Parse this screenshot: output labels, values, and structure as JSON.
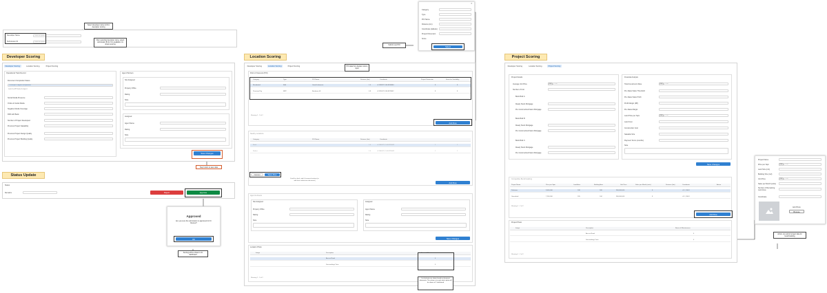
{
  "sections": {
    "developer": "Developer Scoring",
    "status": "Status Update",
    "location": "Location Scoring",
    "project": "Project Scoring"
  },
  "tabs": [
    "Developer Scoring",
    "Location Scoring",
    "Project Scoring"
  ],
  "top_form": {
    "developer_name": "Developer Name",
    "submission_id": "Submission ID",
    "placeholder": "Enter an option",
    "note1": "Select developer name & ID in developer scoring",
    "note2": "After selecting developer name, select submission ID & if it is available it is shown scoring"
  },
  "dev": {
    "op_track": "Operational Track Record",
    "doc_status": "Document Completion Status",
    "doc_opts": [
      "Developer & Agent Incorporated",
      "Land Lot/Private & Agent"
    ],
    "fields": [
      "Social Media Presence",
      "Online & Social Media",
      "Negative Media Coverage",
      "PAR with Bank",
      "Number of Project Developed",
      "Previous Project Saleability",
      "Previous Project Design Quality",
      "Previous Project Building Quality"
    ],
    "agent_partners": "Agent Partners",
    "not_assigned": "Not Assigned",
    "property_office": "Property Office",
    "rating": "Rating",
    "note": "Note",
    "assigned": "Assigned",
    "agent_name": "Agent Name",
    "save": "Save Changes",
    "dev_note": "Step button to save data"
  },
  "status": {
    "label": "Status",
    "remarks": "Remarks",
    "reject": "Reject",
    "approve": "Approve",
    "approved_title": "Approved",
    "approved_body": "Are you sure the submission is approved for IC Review?",
    "ok": "OK",
    "note": "Scoring will be shown in IC dashboard"
  },
  "location": {
    "poi_table": "Point of Interests (POI)",
    "columns": [
      "Category",
      "Type",
      "POI Name",
      "Distance (km)",
      "Coordinate",
      "Project Dimension",
      "Score for Scalability"
    ],
    "rows": [
      [
        "Residential",
        "Mall",
        "Grand Indonesia",
        "1.5",
        "-6.1938227,106.8208484",
        "8",
        "8"
      ],
      [
        "Premium/City",
        "MRT",
        "Bundaran HI",
        "0.8",
        "-6.1916071,106.8229442",
        "8",
        "8"
      ]
    ],
    "nearby": "Nearby Locations",
    "rows2": [
      [
        "Rank",
        "",
        "",
        "1.0",
        "-6.1940071, 106.8229442",
        "1",
        "1"
      ],
      [
        "Radius",
        "",
        "",
        "1.0",
        "-6.1940071, 106.8229442",
        "1",
        "1"
      ]
    ],
    "paging": "Showing 1 - 2 of 2",
    "add_row": "Add Row",
    "cancel": "Cancel",
    "save_row": "Save Row",
    "poi_note": "POI data from Apptax column input",
    "edit_note": "Scroll to check, add, & remove location (as add from submission document)",
    "agent_lbl": "Agent & Assets",
    "location_photo": "Location Photo",
    "photo_cols": [
      "Image",
      "Description",
      "Barrier & Maintenance"
    ],
    "photo_rows": [
      [
        "",
        "Access Road",
        "4"
      ],
      [
        "",
        "Surroundings View",
        "4"
      ]
    ],
    "photo_note": "List of photos are shown based on document submission. The column is to mark which photo will be shown in IC dashboard",
    "save": "Save Changes",
    "dialog_fields": [
      "Category",
      "Type",
      "POI Name",
      "Distance (km)",
      "Coordinate (latitude)",
      "Project Dimension",
      "Score"
    ],
    "dialog_btn": "Select",
    "dialog_note": "Submit new POI"
  },
  "project": {
    "project_details": "Project Details",
    "financial": "Financial Analysis",
    "left_fields": [
      "Average Unit Price",
      "Number of Unit",
      "Bank Bulk A",
      "Ready Stock Mortgage",
      "Pre Construction/Indent Mortgage",
      "Bank Bulk B",
      "Ready Stock Mortgage",
      "Pre Construction/Indent Mortgage",
      "Bank Bulk C",
      "Ready Stock Mortgage",
      "Pre Construction/Indent Mortgage"
    ],
    "right_fields": [
      "Total Investment Value",
      "Pre-Sales Sales Threshold",
      "Pre-Sales Sales Profit",
      "Profit Margin (RP)",
      "Pre-Sales Margin",
      "Land Price per Sqm",
      "Land Cost",
      "Construction Cost",
      "Saleable Size",
      "Payment Terms (months)",
      "Note"
    ],
    "price_tag": "IDR",
    "price_val": "0.00",
    "save": "Save Changes",
    "bench": "Competitive Benchmarking",
    "bench_cols": [
      "Project Name",
      "Price per Sqm",
      "Land Area",
      "Building Area",
      "Unit Price",
      "Sales per Month (units)",
      "Distance (km)",
      "Coordinate",
      "Action"
    ],
    "bench_rows": [
      [
        "Parkview",
        "9,000,000",
        "108",
        "168",
        "900,000,000",
        "8",
        "-6.1, 106.8",
        ""
      ],
      [
        "Greenland",
        "7,200,000",
        "105",
        "144",
        "900,000,000",
        "8",
        "-6.1, 106.8",
        ""
      ]
    ],
    "paging": "Showing 1 - 2 of 2",
    "add_row": "Add Row",
    "photo": "Project Photo",
    "photo_rows": [
      [
        "",
        "Access Road",
        "4"
      ],
      [
        "",
        "Surroundings View",
        "4"
      ]
    ],
    "bm_fields": [
      "Project Name",
      "Price per Sqm",
      "Land Size (m2)",
      "Building Size (m2)",
      "Unit Price",
      "Sales per Month (units)",
      "Number of Remaining Land Area",
      "Coordinate"
    ],
    "upload_lbl": "Add Photo",
    "upload_btn": "Browse",
    "bm_note": "Admin can submit project data for benchmarking"
  }
}
